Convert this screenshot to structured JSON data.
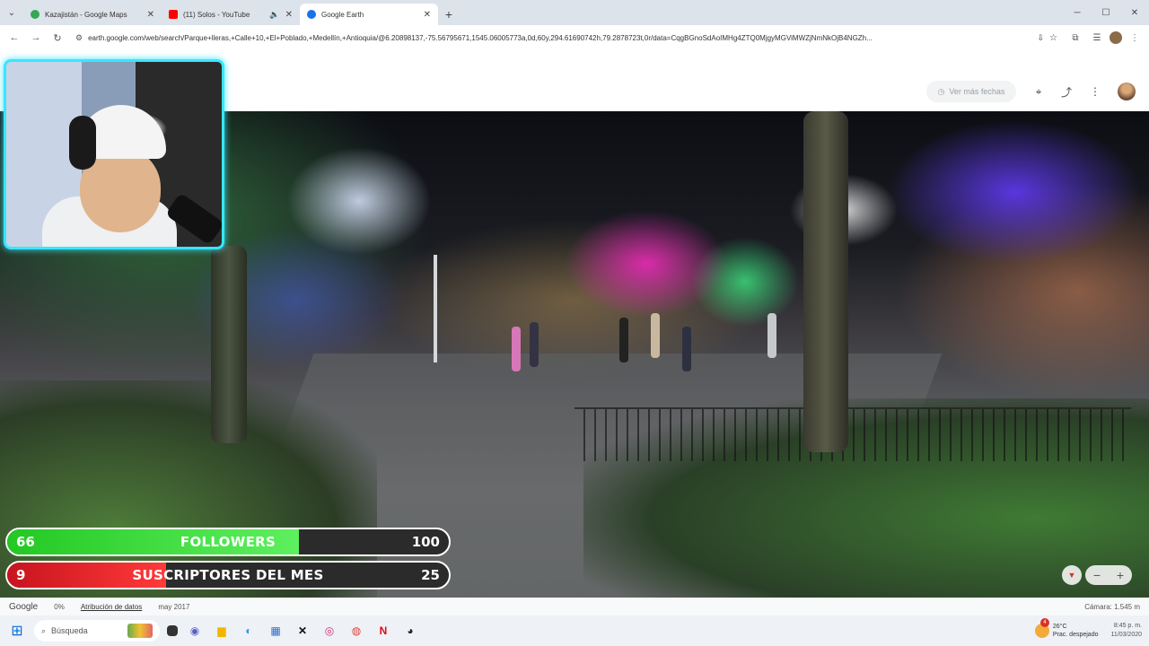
{
  "browser": {
    "tabs": [
      {
        "title": "Kazajistán - Google Maps",
        "favicon_color": "#34a853",
        "active": false
      },
      {
        "title": "(11) Solos - YouTube",
        "favicon_color": "#ff0000",
        "active": false
      },
      {
        "title": "Google Earth",
        "favicon_color": "#1a73e8",
        "active": true
      }
    ],
    "new_tab_glyph": "+",
    "url": "earth.google.com/web/search/Parque+lleras,+Calle+10,+El+Poblado,+Medellín,+Antioquia/@6.20898137,-75.56795671,1545.06005773a,0d,60y,294.61690742h,79.2878723t,0r/data=CqgBGnoSdAoIMHg4ZTQ0MjgyMGViMWZjNmNkOjB4NGZh..."
  },
  "earth": {
    "more_dates_label": "Ver más fechas",
    "status": {
      "logo": "Google",
      "loading": "0%",
      "attribution": "Atribución de datos",
      "date": "may 2017",
      "camera": "Cámara: 1.545 m"
    }
  },
  "stream": {
    "goals": [
      {
        "label": "FOLLOWERS",
        "current": "66",
        "target": "100",
        "fraction": 0.66,
        "color": "#3ee03e"
      },
      {
        "label": "SUSCRIPTORES DEL MES",
        "current": "9",
        "target": "25",
        "fraction": 0.36,
        "color": "#e51f26"
      }
    ]
  },
  "taskbar": {
    "search_placeholder": "Búsqueda",
    "weather": {
      "temp": "26°C",
      "condition": "Prac. despejado",
      "badge": "4"
    },
    "time": "8:45 p. m.",
    "date": "11/03/2020"
  }
}
